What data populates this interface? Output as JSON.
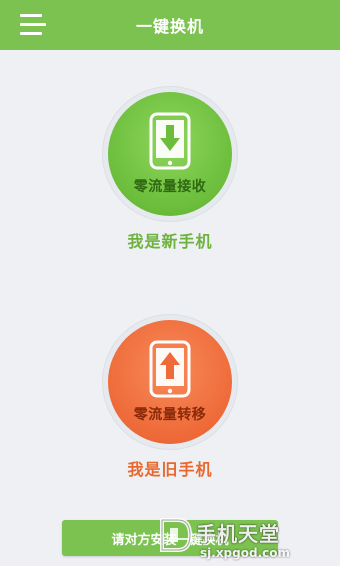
{
  "header": {
    "title": "一键换机",
    "menu_icon": "menu-icon",
    "color": "#7cc250"
  },
  "receive": {
    "circle_label": "零流量接收",
    "role_label": "我是新手机",
    "icon": "phone-download-icon",
    "color": "#6bbd3b"
  },
  "transfer": {
    "circle_label": "零流量转移",
    "role_label": "我是旧手机",
    "icon": "phone-upload-icon",
    "color": "#ee6a38"
  },
  "bottom": {
    "button_label": "请对方安装一键换机"
  },
  "watermark": {
    "name": "手机天堂",
    "url": "sj.xpgod.com",
    "logo": "xpgod-logo"
  }
}
